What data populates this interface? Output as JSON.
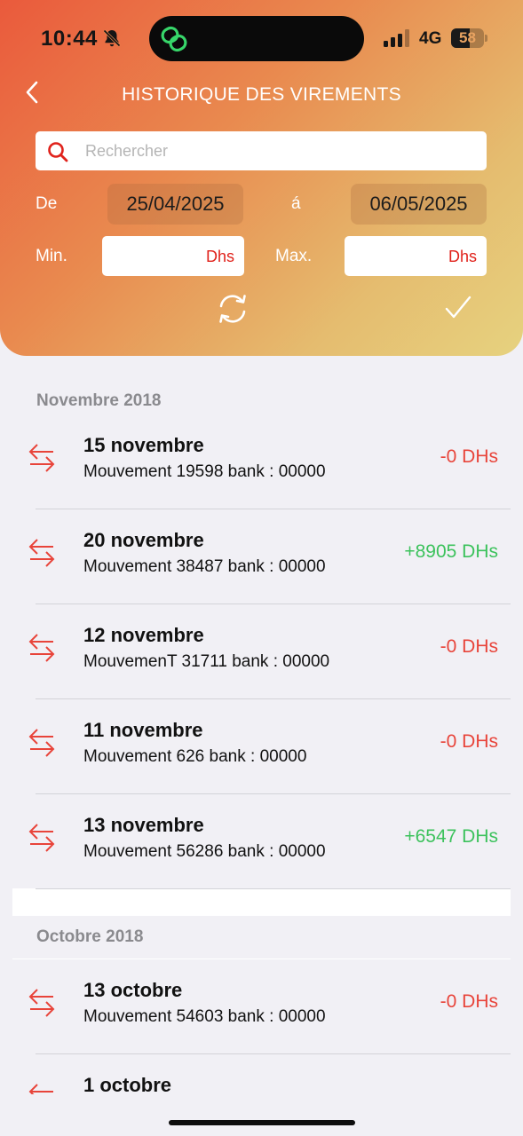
{
  "status_bar": {
    "time": "10:44",
    "network": "4G",
    "battery": "58",
    "battery_level": 0.58
  },
  "header": {
    "title": "HISTORIQUE DES VIREMENTS",
    "search_placeholder": "Rechercher",
    "from_label": "De",
    "from_date": "25/04/2025",
    "to_label": "á",
    "to_date": "06/05/2025",
    "min_label": "Min.",
    "max_label": "Max.",
    "currency_unit": "Dhs"
  },
  "colors": {
    "accent_red": "#e8443a",
    "positive_green": "#3cc25c",
    "header_start": "#ea5a3c",
    "header_end": "#e6d27f"
  },
  "sections": [
    {
      "title": "Novembre 2018",
      "transactions": [
        {
          "date": "15 novembre",
          "description": "Mouvement 19598 bank : 00000",
          "amount": "-0 DHs",
          "sign": "negative"
        },
        {
          "date": "20 novembre",
          "description": "Mouvement 38487 bank : 00000",
          "amount": "+8905 DHs",
          "sign": "positive"
        },
        {
          "date": "12 novembre",
          "description": "MouvemenT 31711 bank : 00000",
          "amount": "-0 DHs",
          "sign": "negative"
        },
        {
          "date": "11 novembre",
          "description": "Mouvement 626 bank : 00000",
          "amount": "-0 DHs",
          "sign": "negative"
        },
        {
          "date": "13 novembre",
          "description": "Mouvement 56286 bank : 00000",
          "amount": "+6547 DHs",
          "sign": "positive"
        }
      ]
    },
    {
      "title": "Octobre 2018",
      "transactions": [
        {
          "date": "13 octobre",
          "description": "Mouvement 54603 bank : 00000",
          "amount": "-0 DHs",
          "sign": "negative"
        },
        {
          "date": "1 octobre",
          "description": "",
          "amount": "",
          "sign": "negative"
        }
      ]
    }
  ]
}
